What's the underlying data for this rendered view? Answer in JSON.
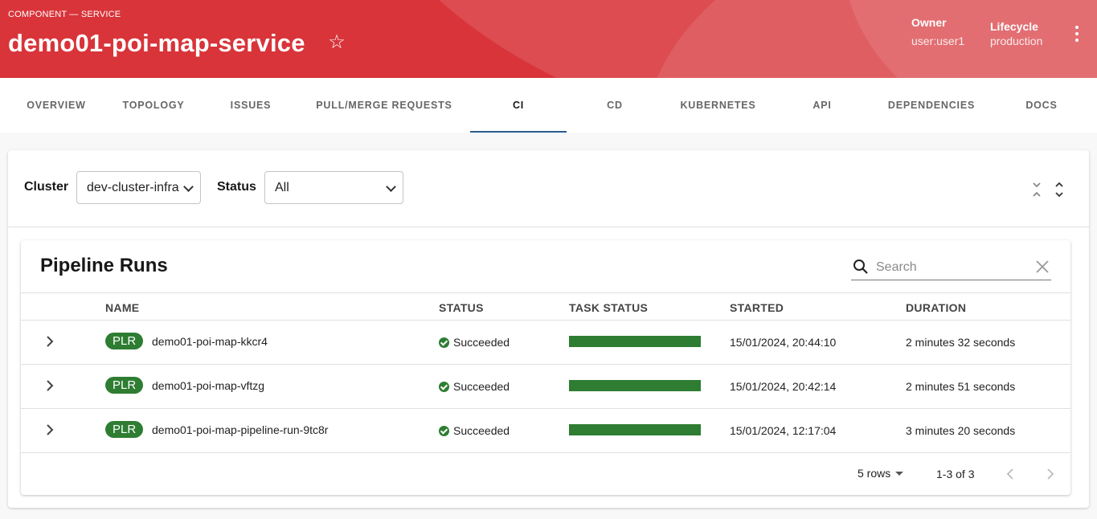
{
  "header": {
    "breadcrumb": "COMPONENT — SERVICE",
    "title": "demo01-poi-map-service",
    "owner_label": "Owner",
    "owner_value": "user:user1",
    "lifecycle_label": "Lifecycle",
    "lifecycle_value": "production",
    "brand_color": "#d8343a"
  },
  "tabs": [
    {
      "label": "OVERVIEW"
    },
    {
      "label": "TOPOLOGY"
    },
    {
      "label": "ISSUES"
    },
    {
      "label": "PULL/MERGE REQUESTS"
    },
    {
      "label": "CI",
      "active": true
    },
    {
      "label": "CD"
    },
    {
      "label": "KUBERNETES"
    },
    {
      "label": "API"
    },
    {
      "label": "DEPENDENCIES"
    },
    {
      "label": "DOCS"
    }
  ],
  "filters": {
    "cluster_label": "Cluster",
    "cluster_value": "dev-cluster-infra",
    "status_label": "Status",
    "status_value": "All"
  },
  "table": {
    "title": "Pipeline Runs",
    "search_placeholder": "Search",
    "columns": [
      "NAME",
      "STATUS",
      "TASK STATUS",
      "STARTED",
      "DURATION"
    ],
    "rows": [
      {
        "badge": "PLR",
        "name": "demo01-poi-map-kkcr4",
        "status": "Succeeded",
        "task_progress": 1.0,
        "started": "15/01/2024, 20:44:10",
        "duration": "2 minutes 32 seconds"
      },
      {
        "badge": "PLR",
        "name": "demo01-poi-map-vftzg",
        "status": "Succeeded",
        "task_progress": 1.0,
        "started": "15/01/2024, 20:42:14",
        "duration": "2 minutes 51 seconds"
      },
      {
        "badge": "PLR",
        "name": "demo01-poi-map-pipeline-run-9tc8r",
        "status": "Succeeded",
        "task_progress": 1.0,
        "started": "15/01/2024, 12:17:04",
        "duration": "3 minutes 20 seconds"
      }
    ],
    "rows_per_page": "5 rows",
    "range": "1-3 of 3",
    "success_color": "#2e7d32"
  }
}
